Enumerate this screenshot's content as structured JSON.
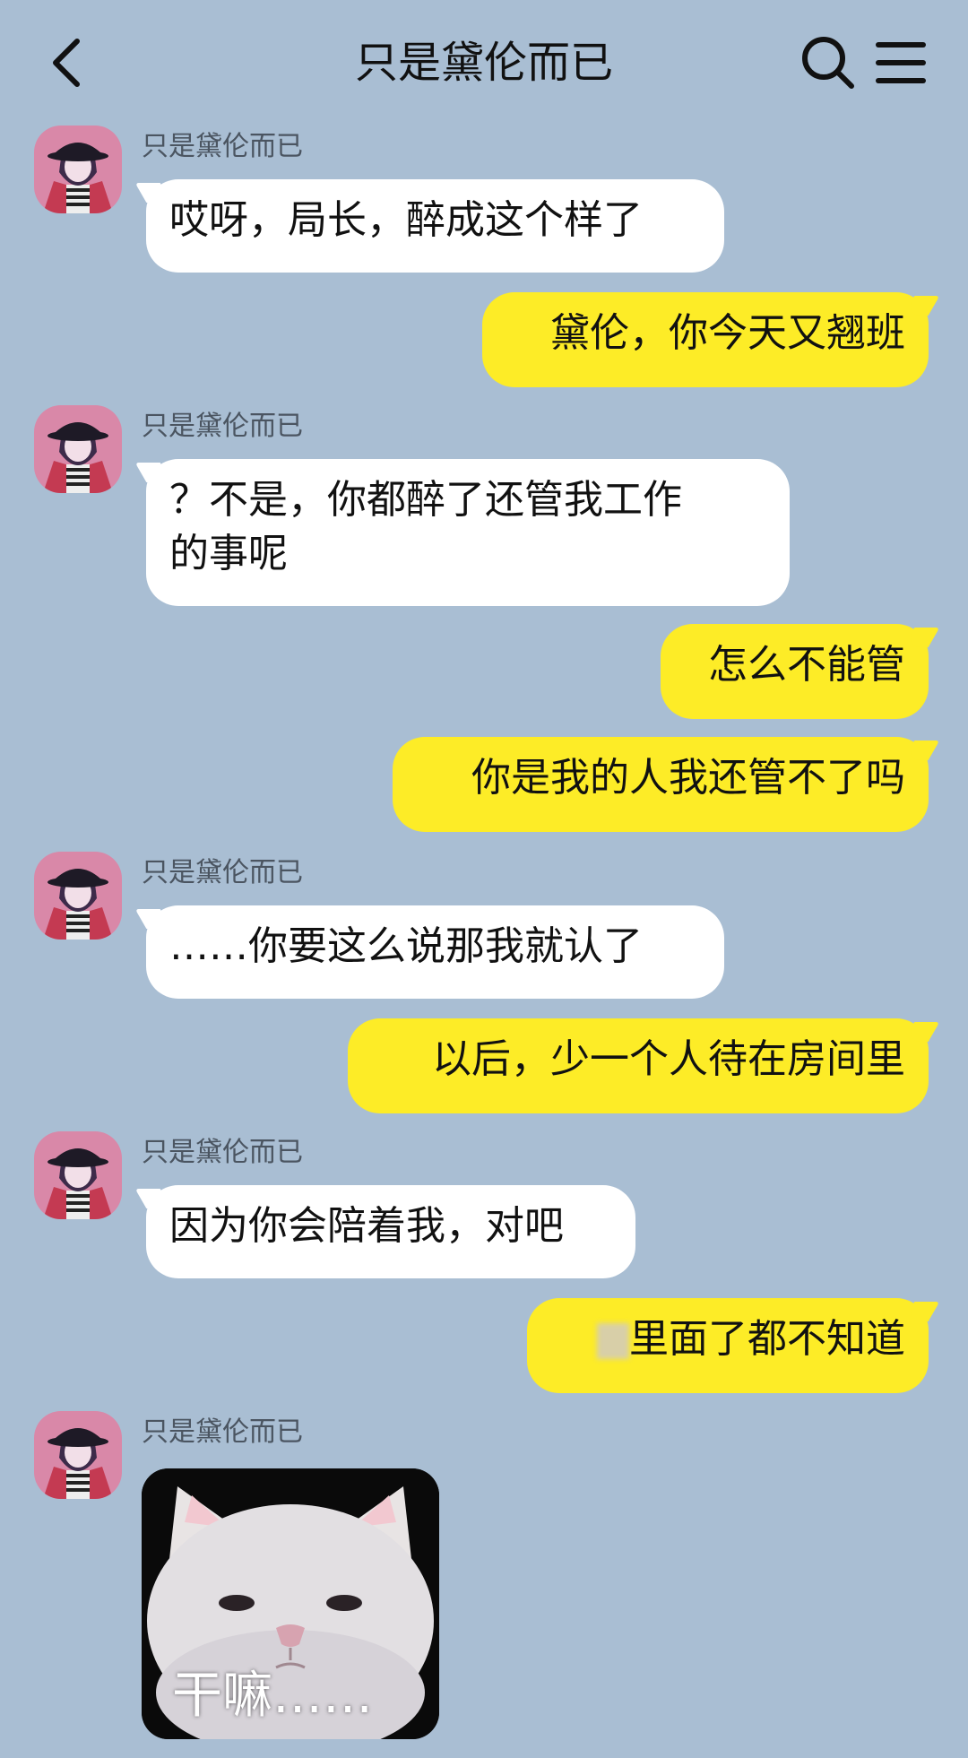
{
  "header": {
    "title": "只是黛伦而已",
    "back_icon": "chevron-left-icon",
    "search_icon": "search-icon",
    "menu_icon": "hamburger-menu-icon"
  },
  "colors": {
    "background": "#a9bed3",
    "incoming_bubble": "#ffffff",
    "outgoing_bubble": "#fdec27",
    "name_text": "#4b5561"
  },
  "messages": [
    {
      "side": "in",
      "sender": "只是黛伦而已",
      "text": "哎呀，局长，醉成这个样了"
    },
    {
      "side": "out",
      "text": "黛伦，你今天又翘班"
    },
    {
      "side": "in",
      "sender": "只是黛伦而已",
      "text": "？不是，你都醉了还管我工作\n的事呢"
    },
    {
      "side": "out",
      "text": "怎么不能管"
    },
    {
      "side": "out",
      "text": "你是我的人我还管不了吗"
    },
    {
      "side": "in",
      "sender": "只是黛伦而已",
      "text": "……你要这么说那我就认了"
    },
    {
      "side": "out",
      "text": "以后，少一个人待在房间里"
    },
    {
      "side": "in",
      "sender": "只是黛伦而已",
      "text": "因为你会陪着我，对吧"
    },
    {
      "side": "out",
      "text": "里面了都不知道"
    },
    {
      "side": "in",
      "sender": "只是黛伦而已",
      "type": "sticker",
      "caption": "干嘛……"
    }
  ]
}
